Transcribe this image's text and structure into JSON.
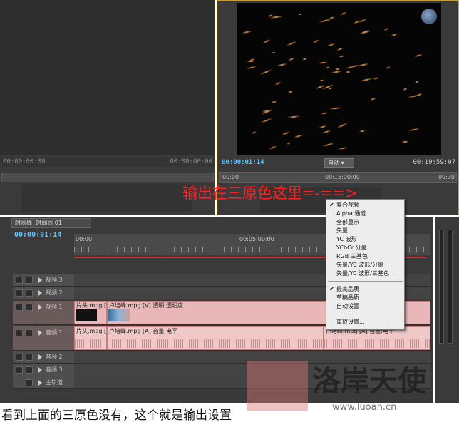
{
  "source_monitor": {
    "timecode_left": "00:00:00:00",
    "timecode_right": "00:00:00:00"
  },
  "program_monitor": {
    "timecode_current": "00:00:01:14",
    "zoom": "自动",
    "timecode_end": "00:19:59:07",
    "ruler_labels": [
      "00:00",
      "00:15:00:00",
      "00:30"
    ]
  },
  "annotation": "输出在三原色这里=-==>",
  "timeline": {
    "tab_label": "时间线: 时间线 01",
    "timecode_current": "00:00:01:14",
    "ruler_labels": [
      "00:00",
      "00:05:00:00"
    ],
    "tracks": [
      {
        "name": "视频 3"
      },
      {
        "name": "视频 2"
      },
      {
        "name": "视频 1",
        "clips": [
          "片头.mpg [V]",
          "卢培峰.mpg [V] 透明:透明度"
        ]
      },
      {
        "name": "音频 1",
        "clips": [
          "片头.mpg [A]",
          "卢培峰.mpg [A] 音量:电平",
          "卢培峰.mpg [A] 音量:电平"
        ]
      },
      {
        "name": "音频 2"
      },
      {
        "name": "音频 3"
      },
      {
        "name": "主轨道"
      }
    ]
  },
  "context_menu": {
    "groups": [
      [
        {
          "label": "复合视频",
          "checked": true
        },
        {
          "label": "Alpha 通道",
          "checked": false
        },
        {
          "label": "全部显示",
          "checked": false
        },
        {
          "label": "矢量",
          "checked": false
        },
        {
          "label": "YC 波形",
          "checked": false
        },
        {
          "label": "YCbCr 分量",
          "checked": false
        },
        {
          "label": "RGB 三基色",
          "checked": false
        },
        {
          "label": "矢量/YC 波形/分量",
          "checked": false
        },
        {
          "label": "矢量/YC 波形/三基色",
          "checked": false
        }
      ],
      [
        {
          "label": "最高品质",
          "checked": true
        },
        {
          "label": "草稿品质",
          "checked": false
        },
        {
          "label": "自动设置",
          "checked": false
        }
      ],
      [
        {
          "label": "重放设置...",
          "checked": false
        }
      ]
    ]
  },
  "caption": "看到上面的三原色没有，这个就是输出设置",
  "watermark": {
    "logo": "洛岸天使",
    "url": "www.luoan.cn"
  }
}
